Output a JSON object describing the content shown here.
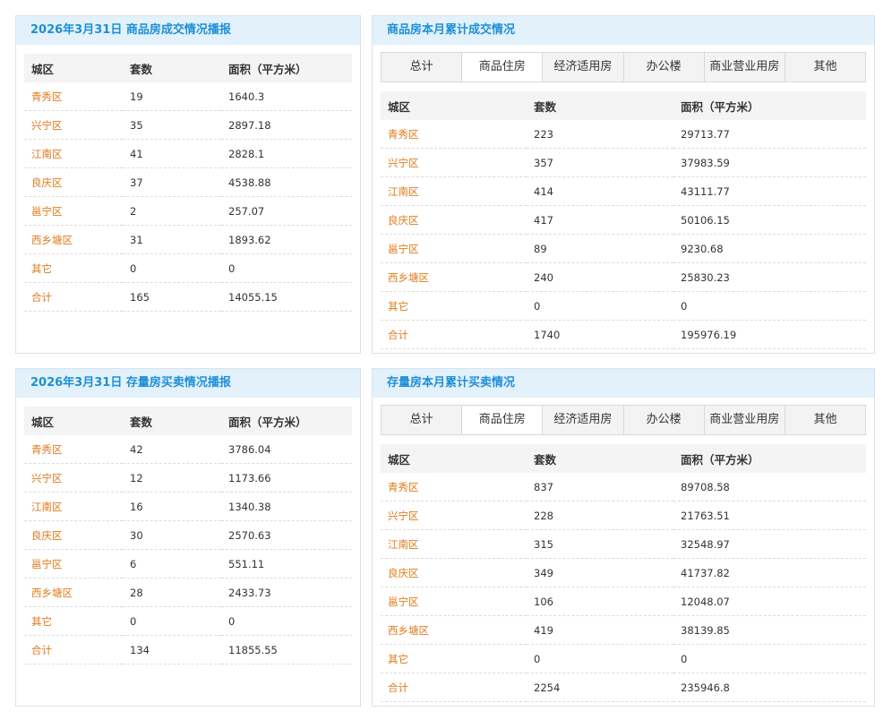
{
  "columns": [
    "城区",
    "套数",
    "面积（平方米）"
  ],
  "tabs": [
    "总计",
    "商品住房",
    "经济适用房",
    "办公楼",
    "商业营业用房",
    "其他"
  ],
  "active_tab_index": 1,
  "colors": {
    "header_bg": "#e3f1fb",
    "header_text": "#1d8fd6",
    "district_text": "#e07b1a"
  },
  "panel1": {
    "title": "2026年3月31日 商品房成交情况播报",
    "rows": [
      [
        "青秀区",
        "19",
        "1640.3"
      ],
      [
        "兴宁区",
        "35",
        "2897.18"
      ],
      [
        "江南区",
        "41",
        "2828.1"
      ],
      [
        "良庆区",
        "37",
        "4538.88"
      ],
      [
        "邕宁区",
        "2",
        "257.07"
      ],
      [
        "西乡塘区",
        "31",
        "1893.62"
      ],
      [
        "其它",
        "0",
        "0"
      ],
      [
        "合计",
        "165",
        "14055.15"
      ]
    ]
  },
  "panel2": {
    "title": "商品房本月累计成交情况",
    "rows": [
      [
        "青秀区",
        "223",
        "29713.77"
      ],
      [
        "兴宁区",
        "357",
        "37983.59"
      ],
      [
        "江南区",
        "414",
        "43111.77"
      ],
      [
        "良庆区",
        "417",
        "50106.15"
      ],
      [
        "邕宁区",
        "89",
        "9230.68"
      ],
      [
        "西乡塘区",
        "240",
        "25830.23"
      ],
      [
        "其它",
        "0",
        "0"
      ],
      [
        "合计",
        "1740",
        "195976.19"
      ]
    ]
  },
  "panel3": {
    "title": "2026年3月31日 存量房买卖情况播报",
    "rows": [
      [
        "青秀区",
        "42",
        "3786.04"
      ],
      [
        "兴宁区",
        "12",
        "1173.66"
      ],
      [
        "江南区",
        "16",
        "1340.38"
      ],
      [
        "良庆区",
        "30",
        "2570.63"
      ],
      [
        "邕宁区",
        "6",
        "551.11"
      ],
      [
        "西乡塘区",
        "28",
        "2433.73"
      ],
      [
        "其它",
        "0",
        "0"
      ],
      [
        "合计",
        "134",
        "11855.55"
      ]
    ]
  },
  "panel4": {
    "title": "存量房本月累计买卖情况",
    "rows": [
      [
        "青秀区",
        "837",
        "89708.58"
      ],
      [
        "兴宁区",
        "228",
        "21763.51"
      ],
      [
        "江南区",
        "315",
        "32548.97"
      ],
      [
        "良庆区",
        "349",
        "41737.82"
      ],
      [
        "邕宁区",
        "106",
        "12048.07"
      ],
      [
        "西乡塘区",
        "419",
        "38139.85"
      ],
      [
        "其它",
        "0",
        "0"
      ],
      [
        "合计",
        "2254",
        "235946.8"
      ]
    ]
  }
}
